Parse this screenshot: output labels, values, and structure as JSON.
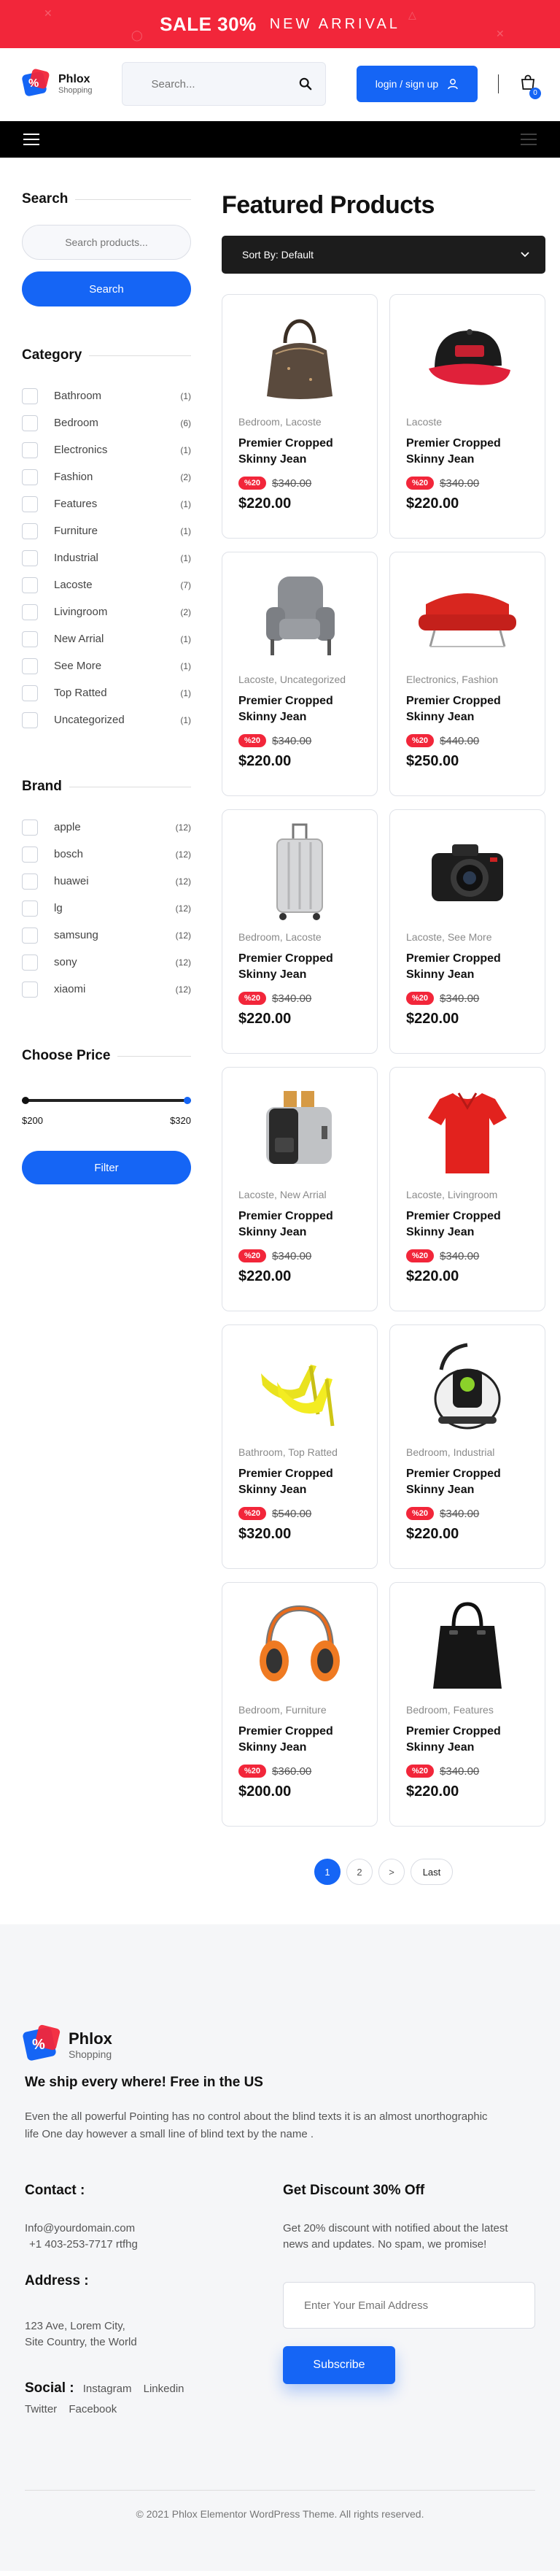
{
  "promo": {
    "sale": "SALE 30%",
    "sub": "NEW ARRIVAL"
  },
  "header": {
    "brand": "Phlox",
    "brand_sub": "Shopping",
    "search_placeholder": "Search...",
    "login_label": "login / sign up",
    "cart_count": "0"
  },
  "sidebar": {
    "search_title": "Search",
    "search_placeholder": "Search products...",
    "search_button": "Search",
    "category_title": "Category",
    "categories": [
      {
        "label": "Bathroom",
        "count": "(1)"
      },
      {
        "label": "Bedroom",
        "count": "(6)"
      },
      {
        "label": "Electronics",
        "count": "(1)"
      },
      {
        "label": "Fashion",
        "count": "(2)"
      },
      {
        "label": "Features",
        "count": "(1)"
      },
      {
        "label": "Furniture",
        "count": "(1)"
      },
      {
        "label": "Industrial",
        "count": "(1)"
      },
      {
        "label": "Lacoste",
        "count": "(7)"
      },
      {
        "label": "Livingroom",
        "count": "(2)"
      },
      {
        "label": "New Arrial",
        "count": "(1)"
      },
      {
        "label": "See More",
        "count": "(1)"
      },
      {
        "label": "Top Ratted",
        "count": "(1)"
      },
      {
        "label": "Uncategorized",
        "count": "(1)"
      }
    ],
    "brand_title": "Brand",
    "brands": [
      {
        "label": "apple",
        "count": "(12)"
      },
      {
        "label": "bosch",
        "count": "(12)"
      },
      {
        "label": "huawei",
        "count": "(12)"
      },
      {
        "label": "lg",
        "count": "(12)"
      },
      {
        "label": "samsung",
        "count": "(12)"
      },
      {
        "label": "sony",
        "count": "(12)"
      },
      {
        "label": "xiaomi",
        "count": "(12)"
      }
    ],
    "price_title": "Choose Price",
    "price_min": "$200",
    "price_max": "$320",
    "filter_button": "Filter"
  },
  "main": {
    "title": "Featured Products",
    "sort_label": "Sort By: Default",
    "products": [
      {
        "icon": "handbag-icon",
        "cats": "Bedroom, Lacoste",
        "name": "Premier Cropped Skinny Jean",
        "disc": "%20",
        "old": "$340.00",
        "price": "$220.00"
      },
      {
        "icon": "cap-icon",
        "cats": "Lacoste",
        "name": "Premier Cropped Skinny Jean",
        "disc": "%20",
        "old": "$340.00",
        "price": "$220.00"
      },
      {
        "icon": "armchair-icon",
        "cats": "Lacoste, Uncategorized",
        "name": "Premier Cropped Skinny Jean",
        "disc": "%20",
        "old": "$340.00",
        "price": "$220.00"
      },
      {
        "icon": "sofa-icon",
        "cats": "Electronics, Fashion",
        "name": "Premier Cropped Skinny Jean",
        "disc": "%20",
        "old": "$440.00",
        "price": "$250.00"
      },
      {
        "icon": "suitcase-icon",
        "cats": "Bedroom, Lacoste",
        "name": "Premier Cropped Skinny Jean",
        "disc": "%20",
        "old": "$340.00",
        "price": "$220.00"
      },
      {
        "icon": "camera-icon",
        "cats": "Lacoste, See More",
        "name": "Premier Cropped Skinny Jean",
        "disc": "%20",
        "old": "$340.00",
        "price": "$220.00"
      },
      {
        "icon": "toaster-icon",
        "cats": "Lacoste, New Arrial",
        "name": "Premier Cropped Skinny Jean",
        "disc": "%20",
        "old": "$340.00",
        "price": "$220.00"
      },
      {
        "icon": "polo-shirt-icon",
        "cats": "Lacoste, Livingroom",
        "name": "Premier Cropped Skinny Jean",
        "disc": "%20",
        "old": "$340.00",
        "price": "$220.00"
      },
      {
        "icon": "high-heels-icon",
        "cats": "Bathroom, Top Ratted",
        "name": "Premier Cropped Skinny Jean",
        "disc": "%20",
        "old": "$540.00",
        "price": "$320.00"
      },
      {
        "icon": "vacuum-cleaner-icon",
        "cats": "Bedroom, Industrial",
        "name": "Premier Cropped Skinny Jean",
        "disc": "%20",
        "old": "$340.00",
        "price": "$220.00"
      },
      {
        "icon": "headphones-icon",
        "cats": "Bedroom, Furniture",
        "name": "Premier Cropped Skinny Jean",
        "disc": "%20",
        "old": "$360.00",
        "price": "$200.00"
      },
      {
        "icon": "tote-bag-icon",
        "cats": "Bedroom, Features",
        "name": "Premier Cropped Skinny Jean",
        "disc": "%20",
        "old": "$340.00",
        "price": "$220.00"
      }
    ],
    "pagination": [
      "1",
      "2",
      ">",
      "Last"
    ]
  },
  "footer": {
    "brand": "Phlox",
    "brand_sub": "Shopping",
    "tagline": "We ship every where! Free in the US",
    "desc": "Even the all powerful Pointing has no control about the blind texts it is an almost unorthographic life One day however a small line of blind text by the name .",
    "contact_title": "Contact :",
    "email": "Info@yourdomain.com",
    "phone": "+1 403-253-7717 rtfhg",
    "address_title": "Address :",
    "address_line1": "123 Ave, Lorem City,",
    "address_line2": "Site Country, the World",
    "social_title": "Social :",
    "social_links": [
      "Instagram",
      "Linkedin",
      "Twitter",
      "Facebook"
    ],
    "discount_title": "Get Discount 30% Off",
    "discount_text": "Get 20% discount with notified about the latest news and updates. No spam, we promise!",
    "email_placeholder": "Enter Your Email Address",
    "subscribe": "Subscribe",
    "copyright": "© 2021 Phlox Elementor WordPress Theme. All rights reserved."
  },
  "colors": {
    "primary": "#1565f5",
    "sale_red": "#f2263a",
    "dark": "#1c1c1c"
  }
}
